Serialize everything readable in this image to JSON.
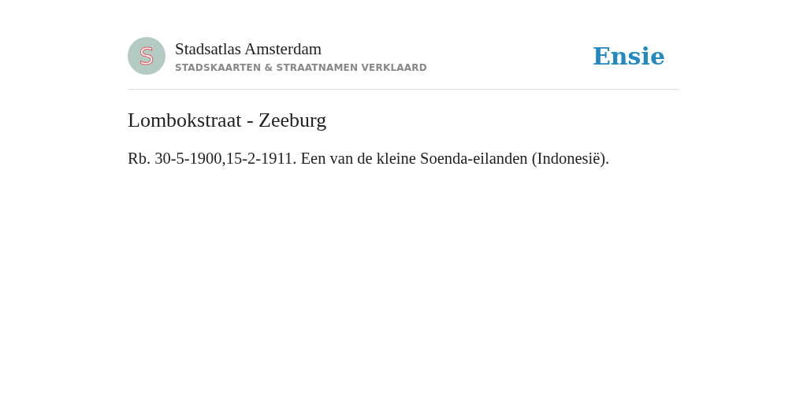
{
  "header": {
    "logo_letter": "S",
    "site_title": "Stadsatlas Amsterdam",
    "tagline": "STADSKAARTEN & STRAATNAMEN VERKLAARD",
    "brand": "Ensie"
  },
  "article": {
    "title": "Lombokstraat - Zeeburg",
    "body": "Rb. 30-5-1900,15-2-1911. Een van de kleine Soenda-eilanden (Indonesië)."
  }
}
